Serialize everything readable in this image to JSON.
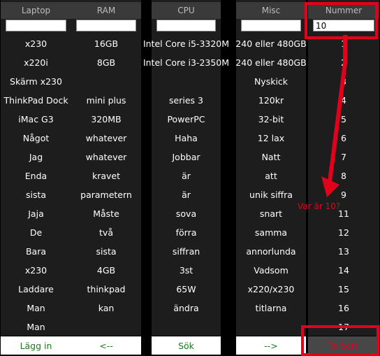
{
  "columns": [
    {
      "header": "Laptop",
      "input_value": "",
      "cells": [
        "x230",
        "x220i",
        "Skärm x230",
        "ThinkPad Dock",
        "iMac G3",
        "Något",
        "Jag",
        "Enda",
        "sista",
        "Jaja",
        "De",
        "Bara",
        "x230",
        "Laddare",
        "Man",
        "Man"
      ]
    },
    {
      "header": "RAM",
      "input_value": "",
      "cells": [
        "16GB",
        "8GB",
        "",
        "mini plus",
        "320MB",
        "whatever",
        "whatever",
        "kravet",
        "parametern",
        "Måste",
        "två",
        "sista",
        "4GB",
        "thinkpad",
        "kan",
        ""
      ]
    },
    {
      "header": "CPU",
      "input_value": "",
      "cells": [
        "Intel Core i5-3320M",
        "Intel Core i3-2350M",
        "",
        "series 3",
        "PowerPC",
        "Haha",
        "Jobbar",
        "är",
        "är",
        "sova",
        "förra",
        "siffran",
        "3st",
        "65W",
        "ändra",
        ""
      ]
    },
    {
      "header": "Misc",
      "input_value": "",
      "cells": [
        "240 eller 480GB",
        "240 eller 480GB",
        "Nyskick",
        "120kr",
        "32-bit",
        "12 lax",
        "Natt",
        "att",
        "unik siffra",
        "snart",
        "samma",
        "annorlunda",
        "Vadsom",
        "x220/x230",
        "titlarna",
        ""
      ]
    },
    {
      "header": "Nummer",
      "input_value": "10",
      "cells": [
        "1",
        "2",
        "3",
        "4",
        "5",
        "6",
        "7",
        "8",
        "9",
        "11",
        "12",
        "13",
        "14",
        "15",
        "16",
        "17"
      ]
    }
  ],
  "buttons": {
    "add": "Lägg in",
    "prev": "<--",
    "search": "Sök",
    "next": "-->",
    "delete": "Ta bort"
  },
  "annotation": {
    "text": "Var är 10?"
  },
  "colors": {
    "accent_red": "#e3001b",
    "button_text_green": "#1a7a1a",
    "background": "#000000"
  }
}
